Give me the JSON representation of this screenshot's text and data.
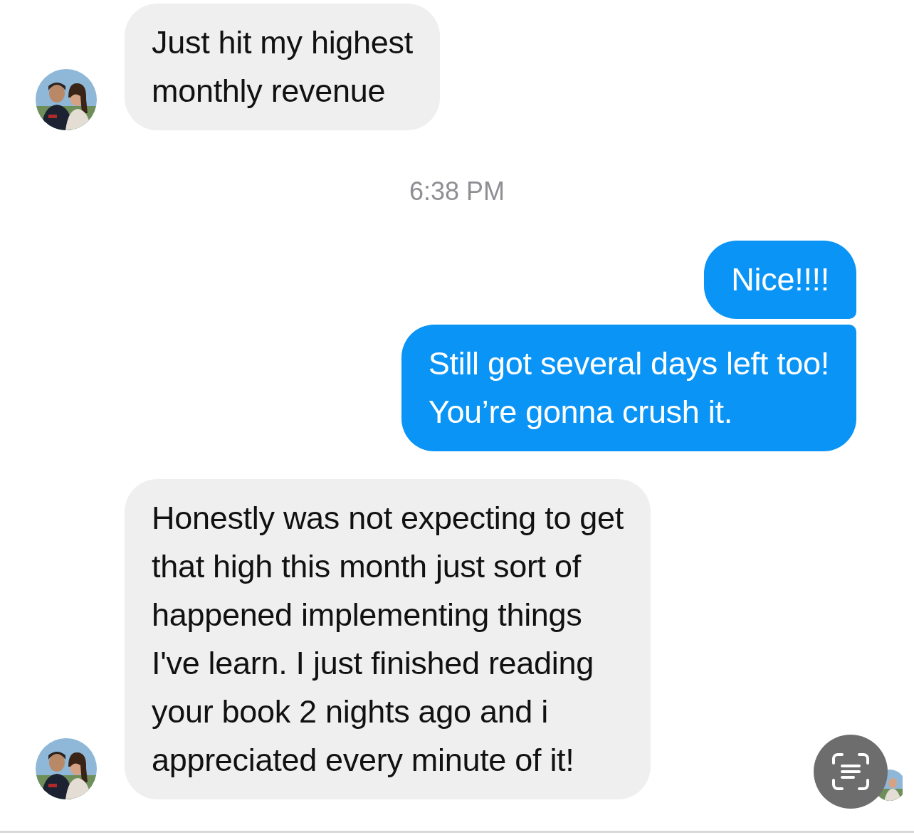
{
  "messages": [
    {
      "kind": "incoming",
      "text": "Just hit my highest\nmonthly revenue",
      "avatar": true
    },
    {
      "kind": "time",
      "text": "6:38 PM"
    },
    {
      "kind": "outgoing",
      "text": "Nice!!!!"
    },
    {
      "kind": "outgoing",
      "text": "Still got several days left too!\nYou’re gonna crush it."
    },
    {
      "kind": "incoming",
      "text": "Honestly was not expecting to get\nthat high this month just sort of\nhappened implementing things\nI've learn. I just finished reading\nyour book 2 nights ago and i\nappreciated every minute of it!",
      "avatar": true
    }
  ]
}
